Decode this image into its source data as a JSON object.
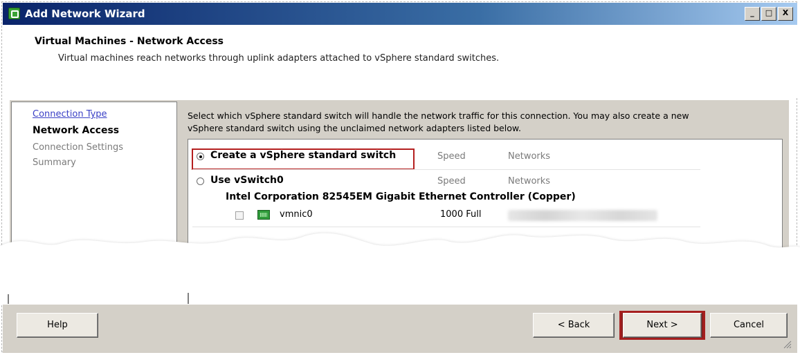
{
  "window": {
    "title": "Add Network Wizard",
    "controls": {
      "minimize": "_",
      "maximize": "□",
      "close": "X"
    }
  },
  "header": {
    "title": "Virtual Machines - Network Access",
    "subtitle": "Virtual machines reach networks through uplink adapters attached to vSphere standard switches."
  },
  "nav": {
    "items": [
      {
        "label": "Connection Type",
        "state": "link"
      },
      {
        "label": "Network Access",
        "state": "current"
      },
      {
        "label": "Connection Settings",
        "state": "inactive"
      },
      {
        "label": "Summary",
        "state": "inactive"
      }
    ]
  },
  "main": {
    "instruction_line1": "Select which vSphere standard switch will handle the network traffic for this connection. You may also create a new",
    "instruction_line2": "vSphere standard switch using the unclaimed network adapters listed below.",
    "options": [
      {
        "label": "Create a vSphere standard switch",
        "checked": true,
        "col_speed": "Speed",
        "col_networks": "Networks"
      },
      {
        "label": "Use vSwitch0",
        "checked": false,
        "col_speed": "Speed",
        "col_networks": "Networks"
      }
    ],
    "adapter_group": "Intel Corporation 82545EM Gigabit Ethernet Controller (Copper)",
    "adapter": {
      "name": "vmnic0",
      "speed": "1000 Full",
      "checked": false
    }
  },
  "footer": {
    "help_label": "Help",
    "back_label": "< Back",
    "next_label": "Next >",
    "cancel_label": "Cancel"
  },
  "colors": {
    "titlebar_start": "#0a246a",
    "titlebar_end": "#a6caf0",
    "dialog_face": "#d4d0c8",
    "highlight_red": "#b41e1e",
    "link_blue": "#3a40c6"
  },
  "icons": [
    "app-icon",
    "network-adapter-icon",
    "resize-grip-icon"
  ]
}
